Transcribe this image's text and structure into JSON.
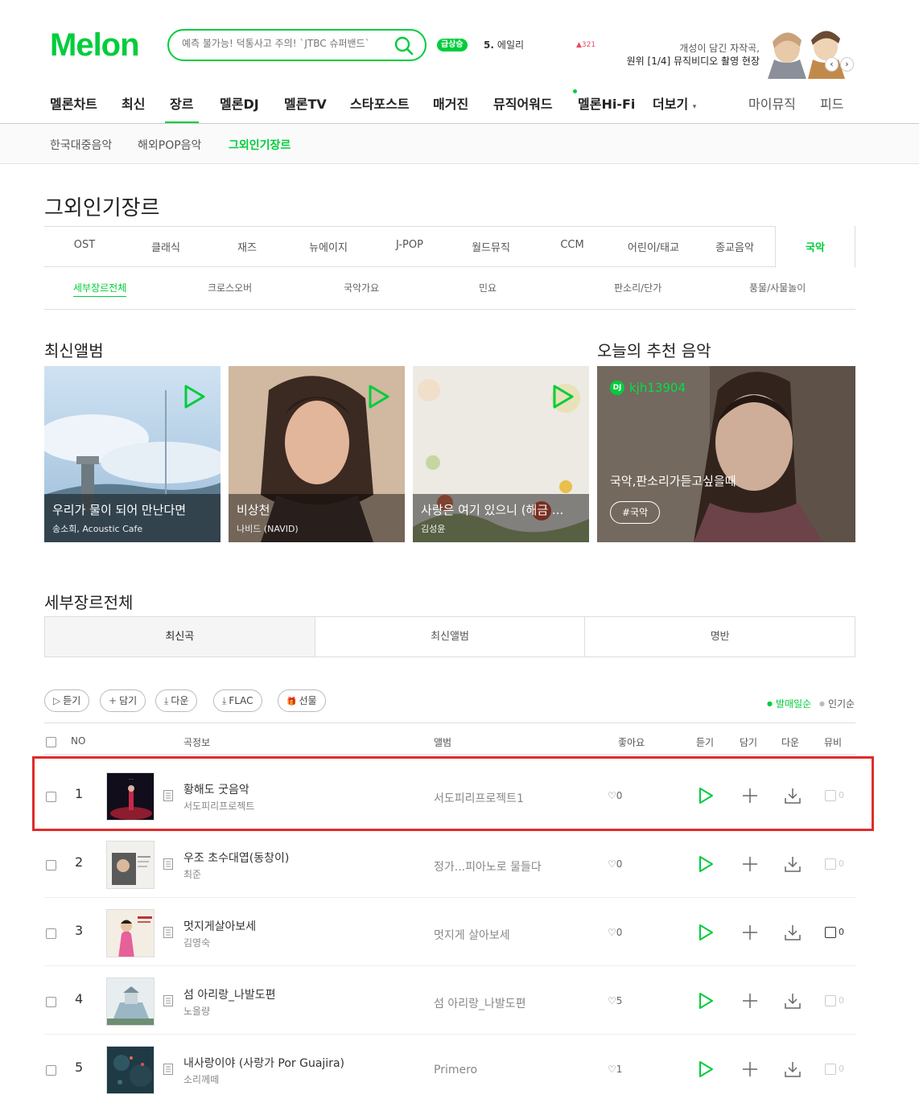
{
  "header": {
    "logo": "Melon",
    "search_placeholder": "예측 불가능! 덕통사고 주의! `JTBC 슈퍼밴드`",
    "rising": {
      "badge": "급상승",
      "rank": "5.",
      "title": "에일리",
      "count": "321"
    },
    "promo": {
      "line1": "개성이 담긴 자작곡,",
      "line2": "원위 [1/4] 뮤직비디오 촬영 현장",
      "prev": "‹",
      "next": "›"
    }
  },
  "gnb": {
    "items": [
      "멜론차트",
      "최신",
      "장르",
      "멜론DJ",
      "멜론TV",
      "스타포스트",
      "매거진",
      "뮤직어워드",
      "멜론Hi-Fi",
      "더보기"
    ],
    "more_caret": "▾",
    "right": [
      "마이뮤직",
      "피드"
    ]
  },
  "subnav": [
    "한국대중음악",
    "해외POP음악",
    "그외인기장르"
  ],
  "page_title": "그외인기장르",
  "genres": [
    "OST",
    "클래식",
    "재즈",
    "뉴에이지",
    "J-POP",
    "월드뮤직",
    "CCM",
    "어린이/태교",
    "종교음악",
    "국악"
  ],
  "sub_genres": [
    "세부장르전체",
    "크로스오버",
    "국악가요",
    "민요",
    "판소리/단가",
    "풍물/사물놀이"
  ],
  "latest_albums": {
    "title": "최신앨범",
    "items": [
      {
        "title": "우리가 물이 되어 만난다면",
        "artist": "송소희, Acoustic Cafe"
      },
      {
        "title": "비상천",
        "artist": "나비드 (NAVID)"
      },
      {
        "title": "사랑은 여기 있으니 (해금 ...",
        "artist": "김성윤"
      }
    ]
  },
  "today": {
    "title": "오늘의 추천 음악",
    "dj_badge": "DJ",
    "dj_name": "kjh13904",
    "playlist": "국악,판소리가듣고싶을때",
    "tag": "#국악"
  },
  "list_section": {
    "title": "세부장르전체",
    "tabs": [
      "최신곡",
      "최신앨범",
      "명반"
    ],
    "buttons": [
      {
        "icon": "play-icon",
        "glyph": "▷",
        "label": "듣기"
      },
      {
        "icon": "plus-icon",
        "glyph": "+",
        "label": "담기"
      },
      {
        "icon": "download-icon",
        "glyph": "⤓",
        "label": "다운"
      },
      {
        "icon": "download-icon",
        "glyph": "⤓",
        "label": "FLAC"
      },
      {
        "icon": "gift-icon",
        "glyph": "🎁",
        "label": "선물"
      }
    ],
    "sort": [
      "발매일순",
      "인기순"
    ],
    "columns": [
      "NO",
      "곡정보",
      "앨범",
      "좋아요",
      "듣기",
      "담기",
      "다운",
      "뮤비"
    ]
  },
  "songs": [
    {
      "no": "1",
      "title": "황해도 굿음악",
      "artist": "서도피리프로젝트",
      "album": "서도피리프로젝트1",
      "likes": "0",
      "mv": "0"
    },
    {
      "no": "2",
      "title": "우조 초수대엽(동창이)",
      "artist": "최준",
      "album": "정가...피아노로 물들다",
      "likes": "0",
      "mv": "0"
    },
    {
      "no": "3",
      "title": "멋지게살아보세",
      "artist": "김영숙",
      "album": "멋지게 살아보세",
      "likes": "0",
      "mv": "0"
    },
    {
      "no": "4",
      "title": "섬 아리랑_나발도편",
      "artist": "노올량",
      "album": "섬 아리랑_나발도편",
      "likes": "5",
      "mv": "0"
    },
    {
      "no": "5",
      "title": "내사랑이야 (사랑가 Por Guajira)",
      "artist": "소리께떼",
      "album": "Primero",
      "likes": "1",
      "mv": "0"
    }
  ],
  "colors": {
    "accent": "#00cd3c",
    "highlight": "#e12b2b"
  }
}
